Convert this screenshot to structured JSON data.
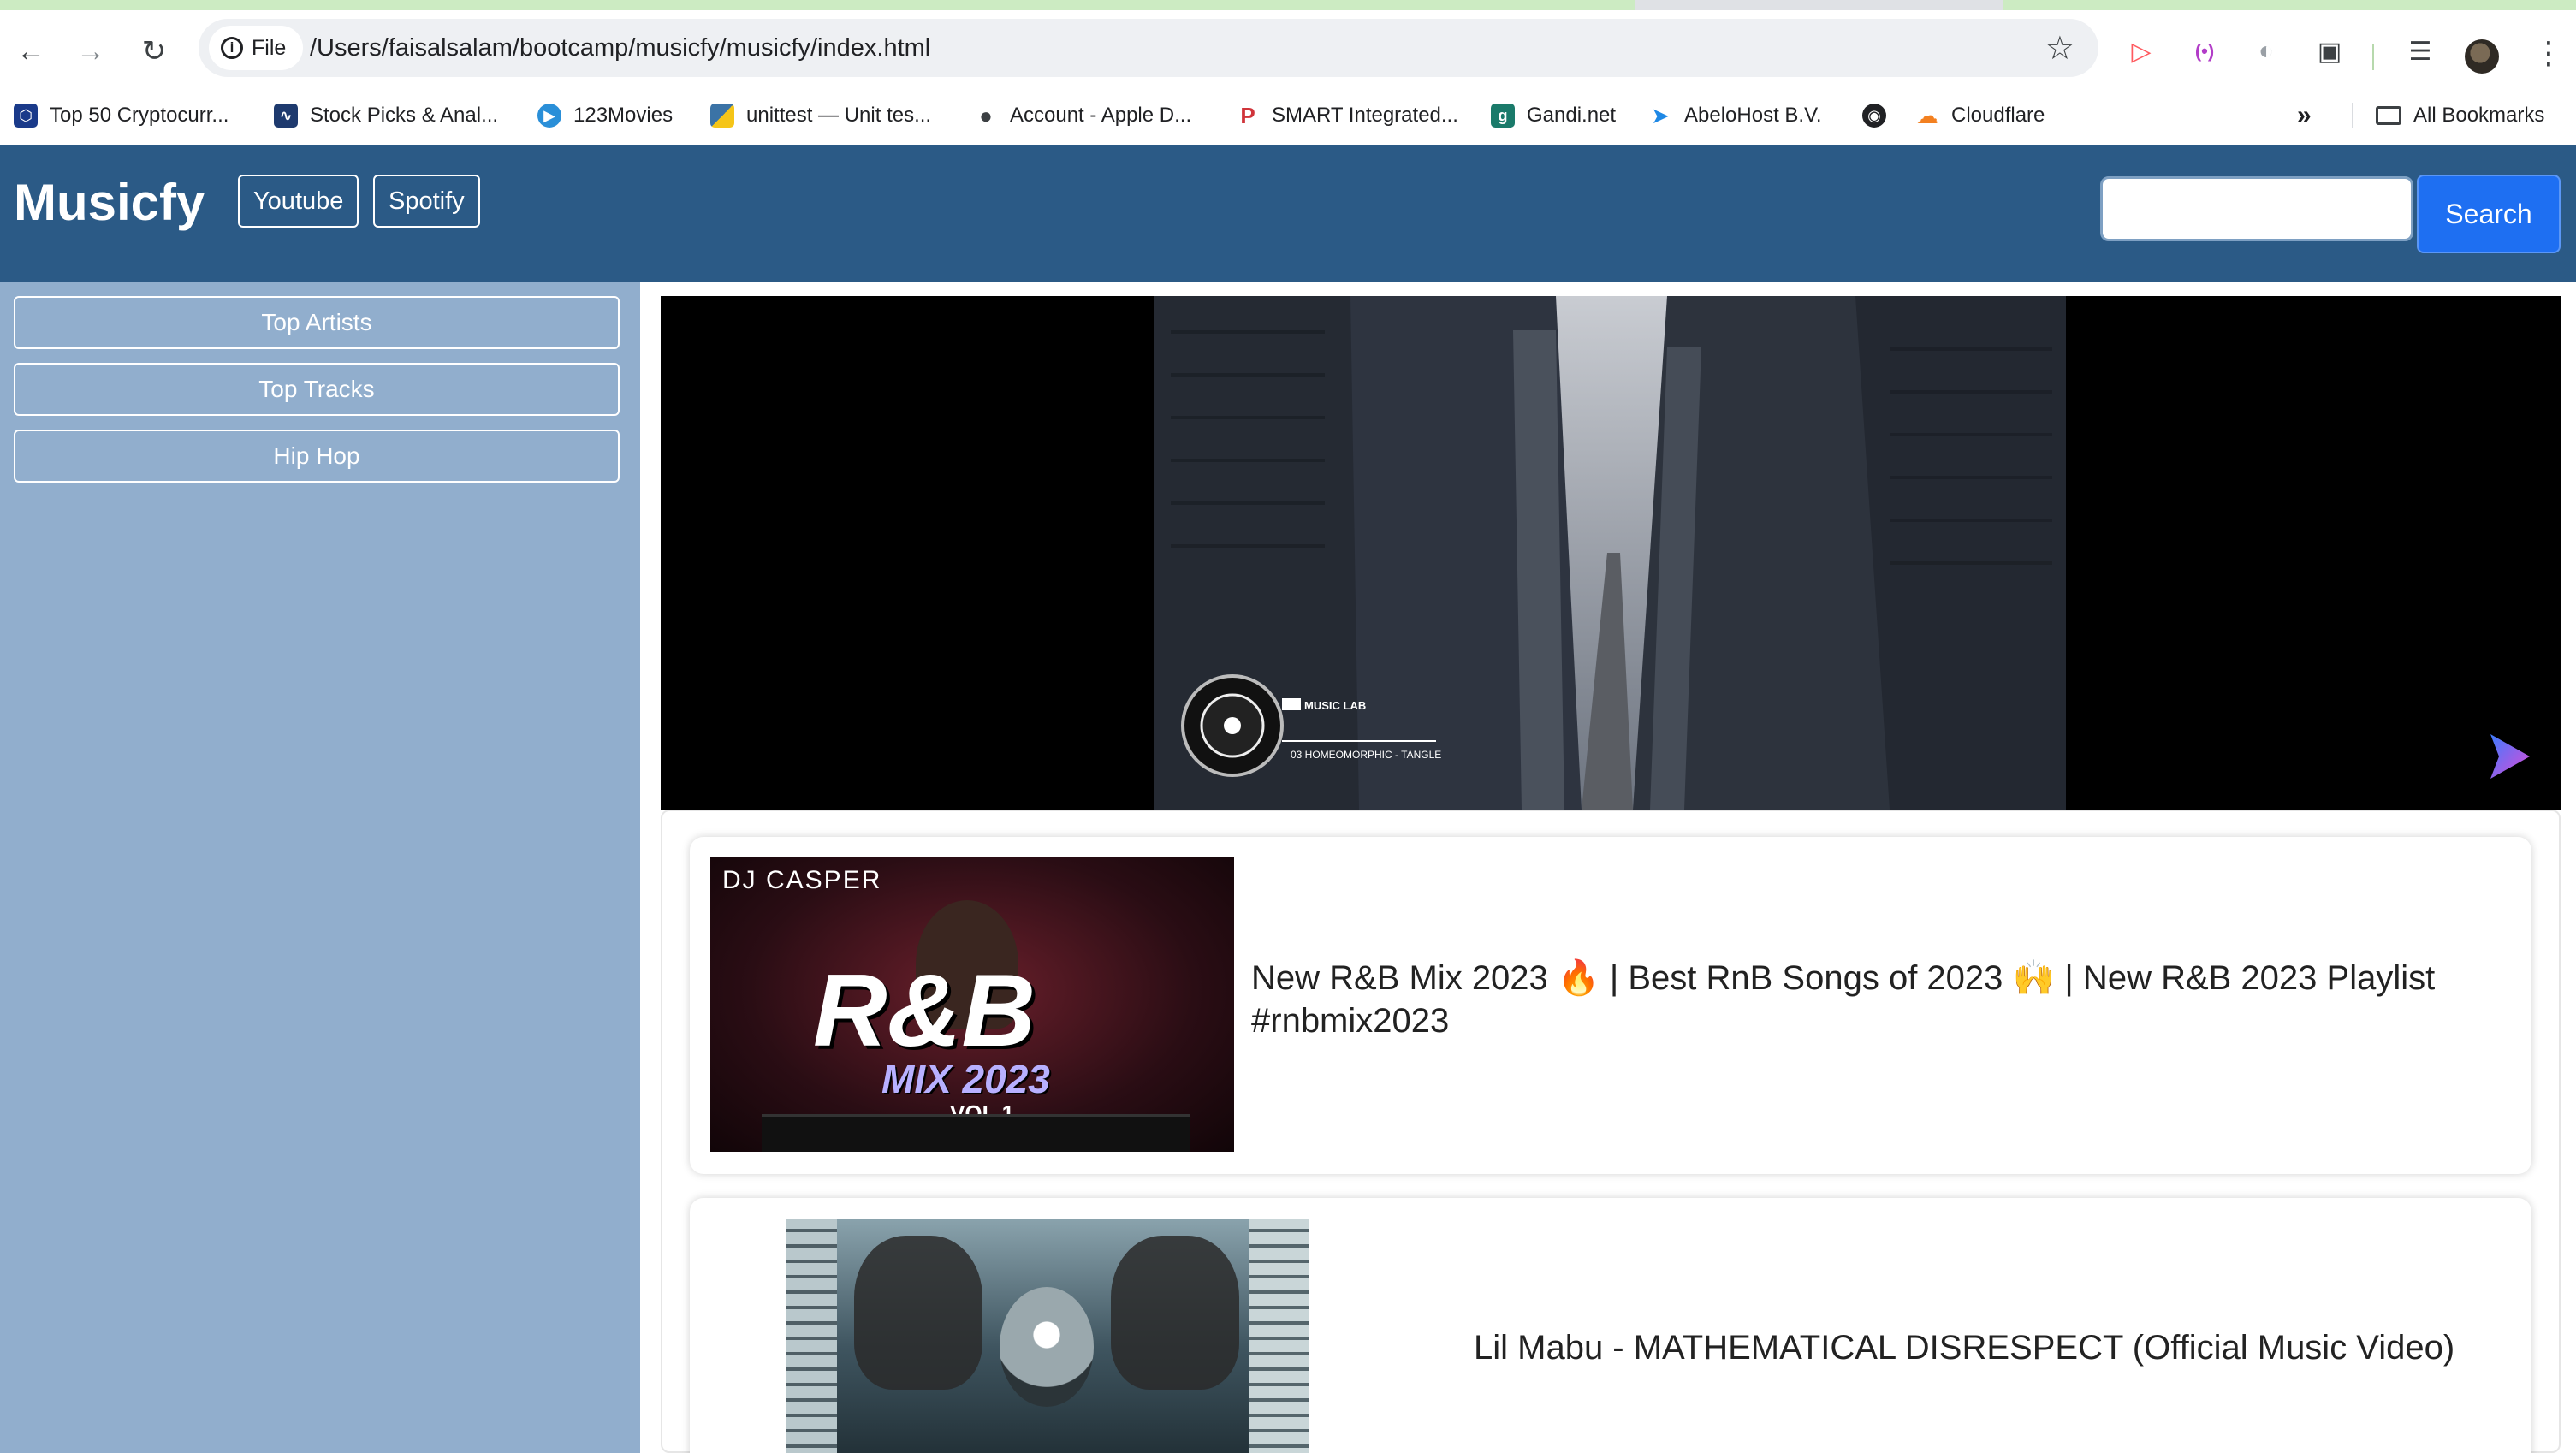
{
  "browser": {
    "site_chip": "File",
    "url": "/Users/faisalsalam/bootcamp/musicfy/musicfy/index.html",
    "bookmarks": [
      {
        "label": "Top 50 Cryptocurr...",
        "icon": "hexagon-icon",
        "color": "#1a3a8a"
      },
      {
        "label": "Stock Picks & Anal...",
        "icon": "chart-icon",
        "color": "#1e3a6e"
      },
      {
        "label": "123Movies",
        "icon": "play-circle-icon",
        "color": "#2a8fd8"
      },
      {
        "label": "unittest — Unit tes...",
        "icon": "python-icon",
        "color": "#3b73a6"
      },
      {
        "label": "Account - Apple D...",
        "icon": "apple-icon",
        "color": "#3c4043"
      },
      {
        "label": "SMART Integrated...",
        "icon": "p-icon",
        "color": "#d0343a"
      },
      {
        "label": "Gandi.net",
        "icon": "gandi-icon",
        "color": "#1a7a6a"
      },
      {
        "label": "AbeloHost B.V.",
        "icon": "bird-icon",
        "color": "#1e88e5"
      },
      {
        "label": "",
        "icon": "globe-icon",
        "color": "#202124"
      },
      {
        "label": "Cloudflare",
        "icon": "cloud-icon",
        "color": "#f38020"
      }
    ],
    "overflow_glyph": "»",
    "all_bookmarks": "All Bookmarks"
  },
  "navbar": {
    "brand": "Musicfy",
    "links": [
      "Youtube",
      "Spotify"
    ],
    "search_value": "",
    "search_button": "Search"
  },
  "sidebar": {
    "items": [
      "Top Artists",
      "Top Tracks",
      "Hip Hop"
    ]
  },
  "player": {
    "overlay_label": "MUSIC LAB",
    "overlay_track": "03 HOMEOMORPHIC - TANGLE"
  },
  "results": [
    {
      "title": "New R&B Mix 2023 🔥 | Best RnB Songs of 2023 🙌 | New R&B 2023 Playlist #rnbmix2023",
      "thumb_brand": "DJ CASPER",
      "thumb_title": "R&B",
      "thumb_subtitle": "MIX 2023",
      "thumb_vol": "VOL.1"
    },
    {
      "title": "Lil Mabu - MATHEMATICAL DISRESPECT (Official Music Video)"
    }
  ]
}
